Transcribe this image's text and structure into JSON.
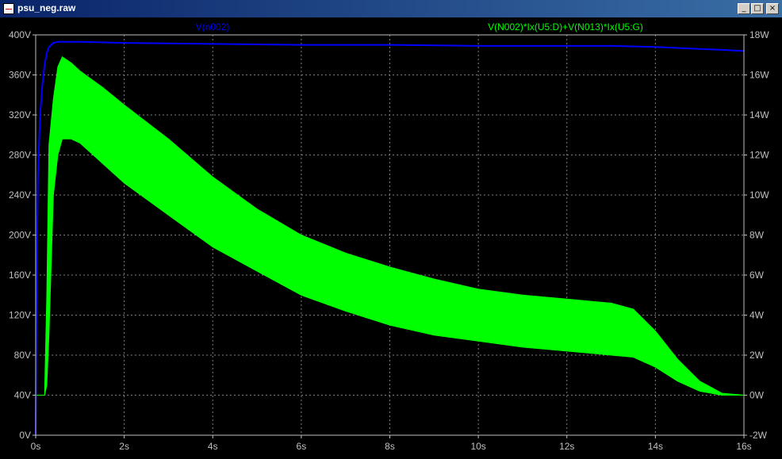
{
  "window": {
    "title": "psu_neg.raw",
    "minimize_glyph": "_",
    "restore_glyph": "□",
    "close_glyph": "×"
  },
  "colors": {
    "background": "#000000",
    "grid": "#7f7f7f",
    "axis_text": "#c0c0c0",
    "series_blue": "#0000ff",
    "series_green": "#00ff00"
  },
  "chart_data": {
    "type": "line",
    "title": "",
    "xlabel": "",
    "x_ticks": [
      "0s",
      "2s",
      "4s",
      "6s",
      "8s",
      "10s",
      "12s",
      "14s",
      "16s"
    ],
    "xlim": [
      0,
      16
    ],
    "left_axis": {
      "ticks": [
        "0V",
        "40V",
        "80V",
        "120V",
        "160V",
        "200V",
        "240V",
        "280V",
        "320V",
        "360V",
        "400V"
      ],
      "ylim": [
        0,
        400
      ]
    },
    "right_axis": {
      "ticks": [
        "-2W",
        "0W",
        "2W",
        "4W",
        "6W",
        "8W",
        "10W",
        "12W",
        "14W",
        "16W",
        "18W"
      ],
      "ylim": [
        -2,
        18
      ]
    },
    "grid": true,
    "legend_placement": "top",
    "series": [
      {
        "name": "V(n002)",
        "axis": "left",
        "color": "#0000ff",
        "x": [
          0,
          0.02,
          0.05,
          0.1,
          0.15,
          0.2,
          0.25,
          0.3,
          0.4,
          0.5,
          1,
          2,
          4,
          6,
          8,
          10,
          12,
          13,
          14,
          15,
          15.5,
          16
        ],
        "y": [
          0,
          150,
          260,
          320,
          350,
          370,
          382,
          388,
          392,
          393,
          393,
          392,
          391,
          390,
          390,
          389,
          389,
          389,
          388,
          386,
          385,
          384
        ]
      },
      {
        "name": "V(N002)*Ix(U5:D)+V(N013)*Ix(U5:G)",
        "axis": "right",
        "color": "#00ff00",
        "x": [
          0,
          0.2,
          0.25,
          0.3,
          0.4,
          0.5,
          0.6,
          0.8,
          1,
          1.5,
          2,
          3,
          4,
          5,
          6,
          7,
          8,
          9,
          10,
          11,
          12,
          13,
          13.5,
          14,
          14.5,
          15,
          15.5,
          16
        ],
        "upper": [
          0,
          0,
          5.0,
          12.5,
          14.8,
          16.4,
          16.9,
          16.6,
          16.2,
          15.4,
          14.5,
          12.8,
          10.9,
          9.3,
          8.0,
          7.1,
          6.4,
          5.8,
          5.3,
          5.0,
          4.8,
          4.6,
          4.3,
          3.2,
          1.8,
          0.7,
          0.1,
          0
        ],
        "lower": [
          0,
          0,
          0.5,
          3.0,
          10.0,
          12.0,
          12.8,
          12.8,
          12.6,
          11.6,
          10.6,
          9.0,
          7.4,
          6.2,
          5.0,
          4.2,
          3.5,
          3.0,
          2.7,
          2.4,
          2.2,
          2.0,
          1.9,
          1.4,
          0.7,
          0.2,
          0,
          0
        ]
      }
    ]
  }
}
